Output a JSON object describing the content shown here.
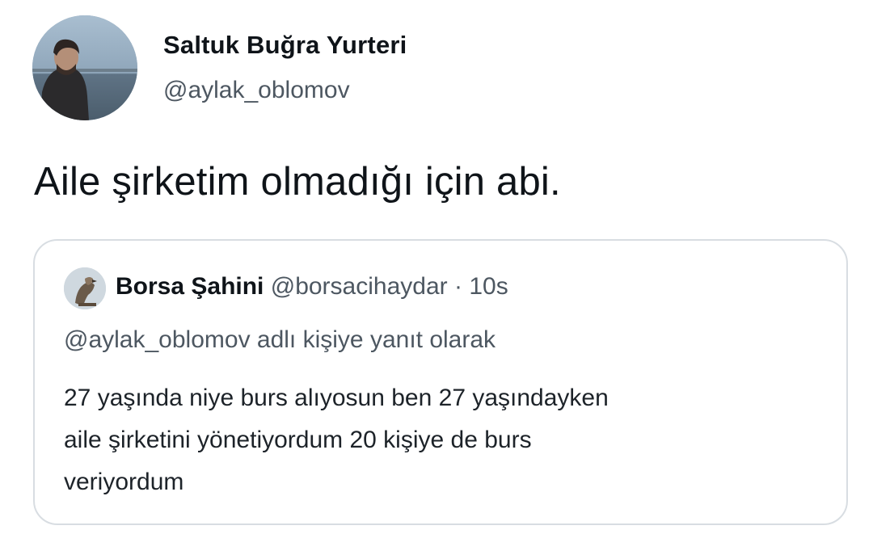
{
  "tweet": {
    "author": {
      "name": "Saltuk Buğra Yurteri",
      "handle": "@aylak_oblomov",
      "avatar_icon": "profile-photo"
    },
    "text": "Aile şirketim olmadığı için abi."
  },
  "quoted_tweet": {
    "author": {
      "name": "Borsa Şahini",
      "handle": "@borsacihaydar",
      "avatar_icon": "hawk-photo"
    },
    "separator": "·",
    "time": "10s",
    "reply_context": "@aylak_oblomov adlı kişiye yanıt olarak",
    "body_lines": [
      "27 yaşında niye burs alıyosun ben 27 yaşındayken",
      "aile şirketini yönetiyordum 20 kişiye de burs",
      "veriyordum"
    ]
  },
  "colors": {
    "text_primary": "#0f1419",
    "text_secondary": "#4d5761",
    "card_border": "#d8dde2",
    "background": "#ffffff"
  }
}
